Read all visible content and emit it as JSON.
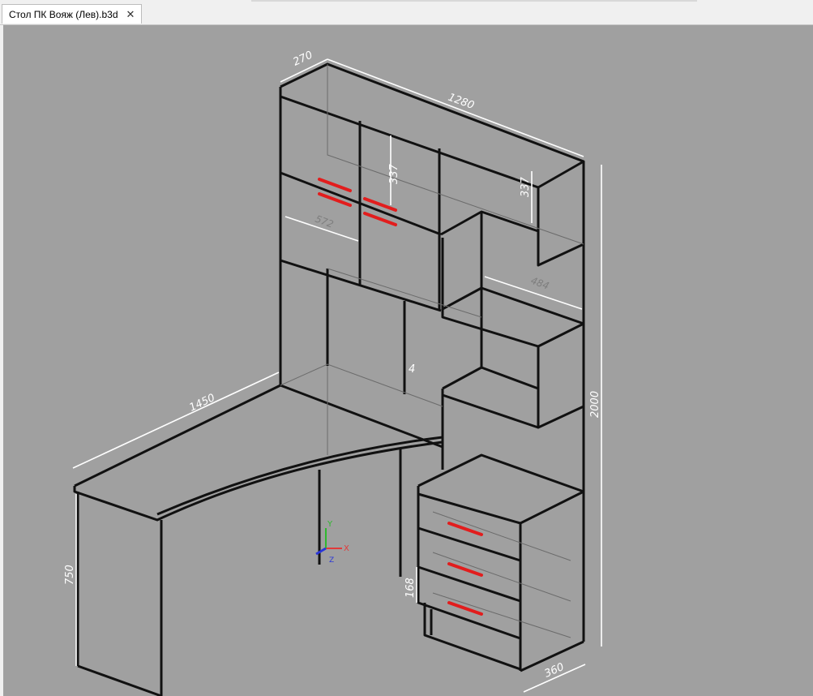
{
  "document_tab": {
    "title": "Стол ПК Вояж (Лев).b3d",
    "close_glyph": "✕"
  },
  "dimensions": {
    "depth_top": "270",
    "width_top": "1280",
    "door_height": "337",
    "shelf_gap": "337",
    "total_height": "2000",
    "desk_length": "1450",
    "desk_height": "750",
    "drawer_height": "168",
    "base_depth": "360",
    "inner_width": "484",
    "door_width": "572",
    "corner_mark": "4"
  },
  "axes": {
    "x": "X",
    "y": "Y",
    "z": "Z"
  },
  "colors": {
    "viewport": "#a0a0a0",
    "line": "#111111",
    "handle": "#e21d1d",
    "dimension": "#ffffff",
    "axis_x": "#e23a3a",
    "axis_y": "#2fb82f",
    "axis_z": "#2a36d8"
  }
}
